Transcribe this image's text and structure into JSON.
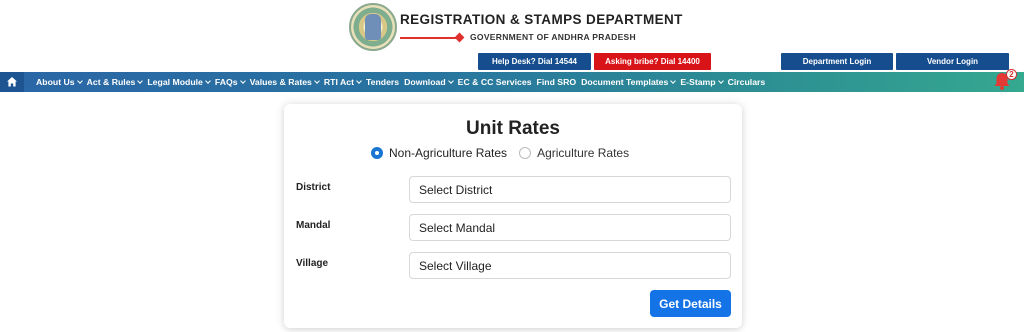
{
  "header": {
    "department": "REGISTRATION & STAMPS DEPARTMENT",
    "government": "GOVERNMENT OF ANDHRA PRADESH",
    "buttons": {
      "helpdesk": "Help Desk? Dial 14544",
      "bribe": "Asking bribe? Dial 14400",
      "department_login": "Department Login",
      "vendor_login": "Vendor Login"
    },
    "colors": {
      "button_blue": "#154d8e",
      "button_red": "#d91419"
    }
  },
  "nav": {
    "home_icon": "home-icon",
    "items": [
      {
        "label": "About Us",
        "dropdown": true
      },
      {
        "label": "Act & Rules",
        "dropdown": true
      },
      {
        "label": "Legal Module",
        "dropdown": true
      },
      {
        "label": "FAQs",
        "dropdown": true
      },
      {
        "label": "Values & Rates",
        "dropdown": true
      },
      {
        "label": "RTI Act",
        "dropdown": true
      },
      {
        "label": "Tenders",
        "dropdown": false
      },
      {
        "label": "Download",
        "dropdown": true
      },
      {
        "label": "EC & CC Services",
        "dropdown": false
      },
      {
        "label": "Find SRO",
        "dropdown": false
      },
      {
        "label": "Document Templates",
        "dropdown": true
      },
      {
        "label": "E-Stamp",
        "dropdown": true
      },
      {
        "label": "Circulars",
        "dropdown": false
      }
    ],
    "notification_count": "2"
  },
  "card": {
    "title": "Unit Rates",
    "radio": {
      "options": [
        {
          "label": "Non-Agriculture Rates",
          "checked": true
        },
        {
          "label": "Agriculture Rates",
          "checked": false
        }
      ]
    },
    "fields": {
      "district": {
        "label": "District",
        "value": "Select District"
      },
      "mandal": {
        "label": "Mandal",
        "value": "Select Mandal"
      },
      "village": {
        "label": "Village",
        "value": "Select Village"
      }
    },
    "submit_label": "Get Details",
    "accent": "#1473e6"
  }
}
